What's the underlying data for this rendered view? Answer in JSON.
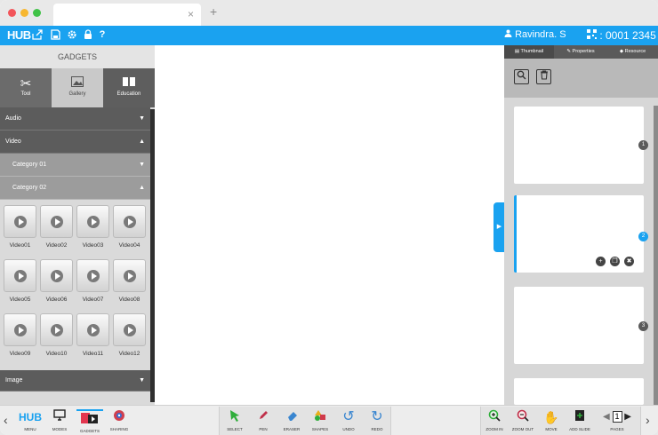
{
  "browser": {
    "new_tab": "+",
    "close": "×"
  },
  "appbar": {
    "logo": "HUB",
    "user": "Ravindra. S",
    "user_icon": "user-icon",
    "code": ": 0001 2345"
  },
  "left_panel": {
    "title": "GADGETS",
    "tabs": [
      {
        "label": "Tool"
      },
      {
        "label": "Gallery"
      },
      {
        "label": "Education"
      }
    ],
    "sections": {
      "audio": "Audio",
      "video": "Video",
      "cat1": "Category 01",
      "cat2": "Category 02",
      "image": "Image"
    },
    "videos": [
      "Video01",
      "Video02",
      "Video03",
      "Video04",
      "Video05",
      "Video06",
      "Video07",
      "Video08",
      "Video09",
      "Video10",
      "Video11",
      "Video12"
    ]
  },
  "right_panel": {
    "tabs": [
      "Thumbnail",
      "Properties",
      "Resource"
    ],
    "slides": [
      "1",
      "2",
      "3"
    ]
  },
  "bottom": {
    "left": [
      "MENU",
      "MODES",
      "GADGETS",
      "SHARING"
    ],
    "center": [
      "SELECT",
      "PEN",
      "ERASER",
      "SHAPES",
      "UNDO",
      "REDO"
    ],
    "right": [
      "ZOOM IN",
      "ZOOM OUT",
      "MOVE",
      "ADD SLIDE"
    ],
    "page": "1",
    "pages_label": "PAGES"
  },
  "colors": {
    "accent": "#1aa2f0",
    "panel_dark": "#5c5c5c"
  }
}
